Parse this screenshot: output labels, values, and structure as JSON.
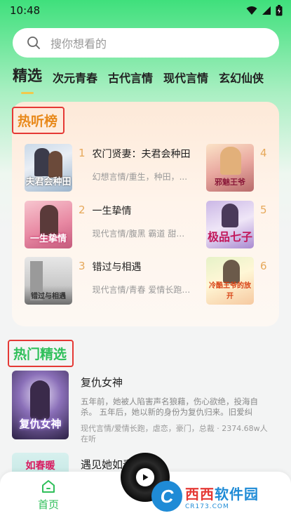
{
  "status_bar": {
    "time": "10:48"
  },
  "search": {
    "placeholder": "搜你想看的"
  },
  "tabs": [
    {
      "label": "精选",
      "active": true
    },
    {
      "label": "次元青春"
    },
    {
      "label": "古代言情"
    },
    {
      "label": "现代言情"
    },
    {
      "label": "玄幻仙侠"
    }
  ],
  "ranking": {
    "title": "热听榜",
    "items": [
      {
        "rank": "1",
        "title": "农门贤妻：夫君会种田",
        "subtitle": "幻想言情/重生，种田，...",
        "cover_text": "夫君会种田"
      },
      {
        "rank": "2",
        "title": "一生挚情",
        "subtitle": "现代言情/腹黑 霸道 甜文...",
        "cover_text": "一生挚情"
      },
      {
        "rank": "3",
        "title": "错过与相遇",
        "subtitle": "现代言情/青春 爱情长跑 ...",
        "cover_text": "错过与相遇"
      },
      {
        "rank": "4",
        "cover_text": "邪魅王爷"
      },
      {
        "rank": "5",
        "cover_text": "极品七子"
      },
      {
        "rank": "6",
        "cover_text": "冷酷王爷的放开"
      }
    ]
  },
  "featured": {
    "title": "热门精选",
    "books": [
      {
        "title": "复仇女神",
        "description": "五年前，她被人陷害声名狼藉，伤心欲绝，投海自杀。 五年后，她以新的身份为复仇归来。旧爱纠葛...",
        "meta": "现代言情/爱情长跑，虐恋，豪门，总裁 · 2374.68w人在听",
        "cover_text": "复仇女神"
      },
      {
        "title": "遇见她如春",
        "cover_text": "如春暖"
      }
    ]
  },
  "bottom_nav": {
    "home_label": "首页"
  },
  "watermark": {
    "brand_a": "西西",
    "brand_b": "软件园",
    "url": "CR173.COM"
  },
  "colors": {
    "accent": "#2fbf5a",
    "rank_title": "#e8891b",
    "highlight_box": "#e53935"
  }
}
